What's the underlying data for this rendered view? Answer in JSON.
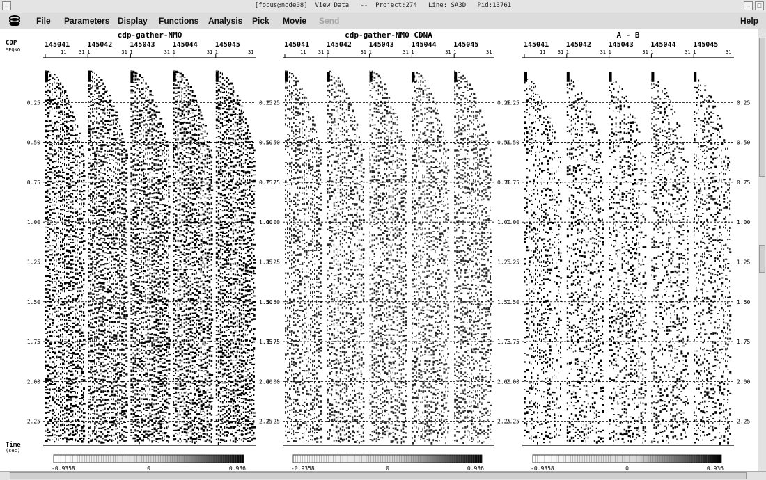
{
  "window": {
    "title": "[focus@node08]  View Data   --  Project:274   Line: SA3D   Pid:13761",
    "min_glyph": "–",
    "max_glyph": "□"
  },
  "menu": {
    "items": [
      "File",
      "Parameters",
      "Display",
      "Functions",
      "Analysis",
      "Pick",
      "Movie",
      "Send"
    ],
    "help": "Help"
  },
  "axis": {
    "cdp_label": "CDP",
    "seqno_label": "SEQNO",
    "time_label": "Time",
    "time_unit": "(sec)",
    "time_ticks": [
      "0.25",
      "0.50",
      "0.75",
      "1.00",
      "1.25",
      "1.50",
      "1.75",
      "2.00",
      "2.25"
    ]
  },
  "panels": [
    {
      "title": "cdp-gather-NMO",
      "cdps": [
        "145041",
        "145042",
        "145043",
        "145044",
        "145045"
      ],
      "seqno_first": "11",
      "seqno_mid": [
        "31",
        "1"
      ],
      "seqno_last": "31",
      "colorbar": {
        "min": "-0.9358",
        "mid": "0",
        "max": "0.936"
      }
    },
    {
      "title": "cdp-gather-NMO CDNA",
      "cdps": [
        "145041",
        "145042",
        "145043",
        "145044",
        "145045"
      ],
      "seqno_first": "11",
      "seqno_mid": [
        "31",
        "1"
      ],
      "seqno_last": "31",
      "colorbar": {
        "min": "-0.9358",
        "mid": "0",
        "max": "0.936"
      }
    },
    {
      "title": "A - B",
      "cdps": [
        "145041",
        "145042",
        "145043",
        "145044",
        "145045"
      ],
      "seqno_first": "11",
      "seqno_mid": [
        "31",
        "1"
      ],
      "seqno_last": "31",
      "colorbar": {
        "min": "-0.9358",
        "mid": "0",
        "max": "0.936"
      }
    }
  ],
  "colors": {
    "background": "#ffffff",
    "menubar": "#dcdcdc",
    "wiggle": "#000000",
    "grid": "#000000"
  }
}
